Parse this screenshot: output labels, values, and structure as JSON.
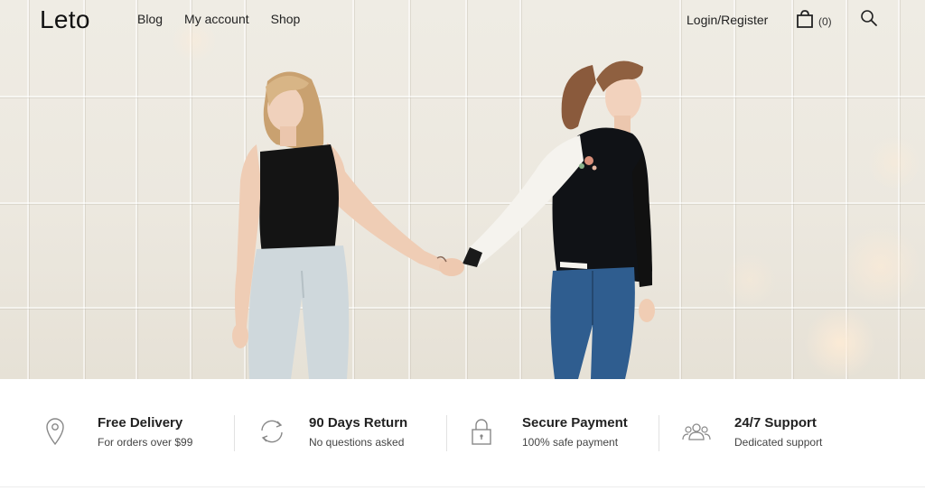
{
  "brand": {
    "logo": "Leto"
  },
  "nav": {
    "items": [
      {
        "label": "Blog"
      },
      {
        "label": "My account"
      },
      {
        "label": "Shop"
      }
    ]
  },
  "header": {
    "login_label": "Login/Register",
    "cart_count": "(0)",
    "icons": {
      "cart": "shopping-bag-icon",
      "search": "search-icon"
    }
  },
  "hero": {
    "image": "two-women-holding-hands-photo"
  },
  "features": [
    {
      "icon": "map-pin-icon",
      "title": "Free Delivery",
      "subtitle": "For orders over $99"
    },
    {
      "icon": "refresh-icon",
      "title": "90 Days Return",
      "subtitle": "No questions asked"
    },
    {
      "icon": "padlock-icon",
      "title": "Secure Payment",
      "subtitle": "100% safe payment"
    },
    {
      "icon": "users-icon",
      "title": "24/7 Support",
      "subtitle": "Dedicated support"
    }
  ],
  "colors": {
    "text": "#222222",
    "icon": "#888888",
    "hero_bg": "#ece8df"
  }
}
